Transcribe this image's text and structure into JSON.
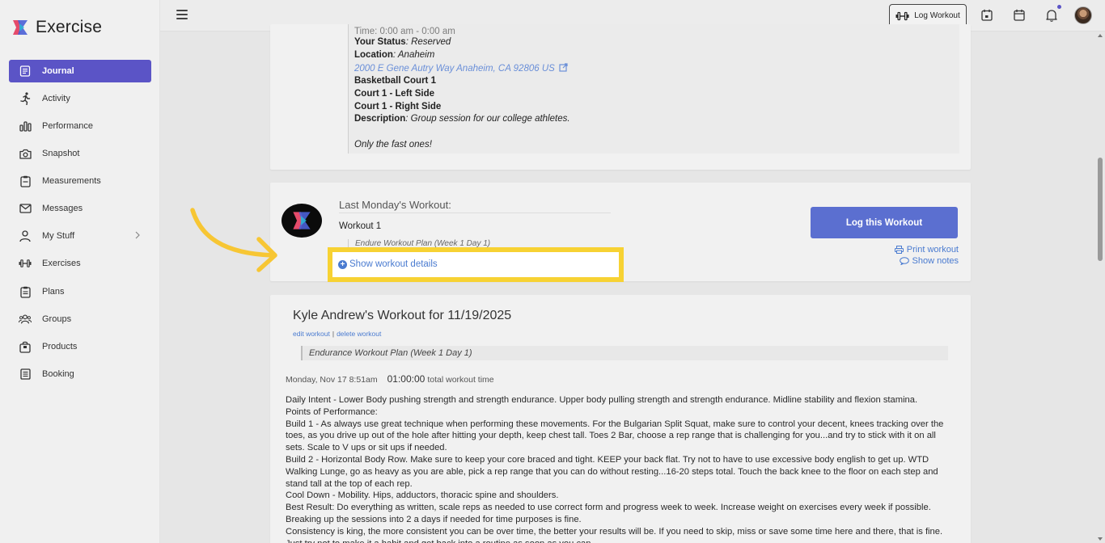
{
  "app": {
    "name": "Exercise"
  },
  "sidebar": {
    "items": [
      {
        "label": "Journal",
        "icon": "journal-icon",
        "active": true
      },
      {
        "label": "Activity",
        "icon": "running-icon"
      },
      {
        "label": "Performance",
        "icon": "bar-chart-icon"
      },
      {
        "label": "Snapshot",
        "icon": "camera-icon"
      },
      {
        "label": "Measurements",
        "icon": "clipboard-icon"
      },
      {
        "label": "Messages",
        "icon": "mail-icon"
      },
      {
        "label": "My Stuff",
        "icon": "user-icon",
        "has_submenu": true
      },
      {
        "label": "Exercises",
        "icon": "dumbbell-icon"
      },
      {
        "label": "Plans",
        "icon": "clipboard-list-icon"
      },
      {
        "label": "Groups",
        "icon": "users-icon"
      },
      {
        "label": "Products",
        "icon": "bag-icon"
      },
      {
        "label": "Booking",
        "icon": "list-icon"
      }
    ]
  },
  "topbar": {
    "log_workout_label": "Log Workout",
    "accent_color": "#5b54c6"
  },
  "event": {
    "time_partial": "Time: 0:00 am - 0:00 am",
    "status_label": "Your Status",
    "status_value": ": Reserved",
    "location_label": "Location",
    "location_value": ": Anaheim",
    "address": "2000 E Gene Autry Way Anaheim, CA 92806 US",
    "court_main": "Basketball Court 1",
    "court_left": "Court 1 - Left Side",
    "court_right": "Court 1 - Right Side",
    "description_label": "Description",
    "description_value": ": Group session for our college athletes.",
    "note": "Only the fast ones!"
  },
  "last_workout": {
    "heading": "Last Monday's Workout:",
    "name": "Workout 1",
    "plan_hint": "Endure Workout Plan (Week 1 Day 1)",
    "show_details": "Show workout details",
    "log_button": "Log this Workout",
    "print_link": "Print workout",
    "notes_link": "Show notes"
  },
  "workout": {
    "title": "Kyle Andrew's Workout for 11/19/2025",
    "edit_link": "edit workout",
    "separator": "|",
    "delete_link": "delete workout",
    "plan": "Endurance Workout Plan (Week 1 Day 1)",
    "date": "Monday, Nov 17 8:51am",
    "duration": "01:00:00",
    "duration_label": "total workout time",
    "description": [
      "Daily Intent - Lower Body pushing strength and strength endurance. Upper body pulling strength and strength endurance. Midline stability and flexion stamina.",
      "Points of Performance:",
      "Build 1 - As always use great technique when performing these movements. For the Bulgarian Split Squat, make sure to control your decent, knees tracking over the toes, as you drive up out of the hole after hitting your depth, keep chest tall. Toes 2 Bar, choose a rep range that is challenging for you...and try to stick with it on all sets. Scale to V ups or sit ups if needed.",
      "Build 2 - Horizontal Body Row. Make sure to keep your core braced and tight. KEEP your back flat. Try not to have to use excessive body english to get up. WTD Walking Lunge, go as heavy as you are able, pick a rep range that you can do without resting...16-20 steps total. Touch the back knee to the floor on each step and stand tall at the top of each rep.",
      "Cool Down - Mobility. Hips, adductors, thoracic spine and shoulders.",
      "Best Result: Do everything as written, scale reps as needed to use correct form and progress week to week. Increase weight on exercises every week if possible. Breaking up the sessions into 2 a days if needed for time purposes is fine.",
      "Consistency is king, the more consistent you can be over time, the better your results will be. If you need to skip, miss or save some time here and there, that is fine. Just try not to make it a habit and get back into a routine as soon as you can."
    ]
  }
}
